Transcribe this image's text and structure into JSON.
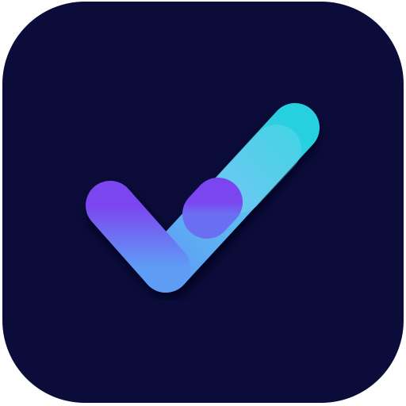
{
  "app_icon": {
    "icon": "checkmark-icon",
    "background_color": "#0b0c3a",
    "colors": {
      "purple": "#7b45ef",
      "blue": "#5f9df5",
      "light_blue": "#5cc1ef",
      "cyan": "#27d0df",
      "shadow": "#04051f"
    }
  }
}
